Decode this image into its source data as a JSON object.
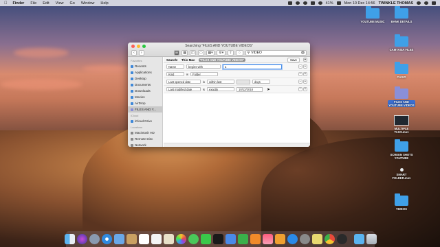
{
  "menubar": {
    "apple": "",
    "app_name": "Finder",
    "menus": [
      "File",
      "Edit",
      "View",
      "Go",
      "Window",
      "Help"
    ],
    "battery": "41%",
    "clock": "Mon 10 Dec  14:56",
    "user": "TWINKLE THOMAS"
  },
  "desktop_icons": [
    {
      "label": "YOUTUBE MUSIC",
      "kind": "folder"
    },
    {
      "label": "BANK DETAILS",
      "kind": "folder"
    },
    {
      "label": "CAMTASIA FILES",
      "kind": "folder"
    },
    {
      "label": "CASIO",
      "kind": "folder"
    },
    {
      "label": "FILES AND\nYOUTUBE VIDEOS",
      "kind": "smart-folder"
    },
    {
      "label": "MULTIPLE\nTAGS.mov",
      "kind": "movie"
    },
    {
      "label": "SCREEN SHOTS\nYOUTUBE",
      "kind": "folder"
    },
    {
      "label": "SMART\nFOLDER.mov",
      "kind": "movie"
    },
    {
      "label": "VIDEOS",
      "kind": "folder"
    }
  ],
  "window": {
    "title": "Searching “FILES AND YOUTUBE VIDEOS”",
    "search_value": "VIDEO",
    "sidebar": {
      "favorites_heading": "Favorites",
      "favorites": [
        "Recents",
        "Applications",
        "Desktop",
        "Documents",
        "Downloads",
        "Movies",
        "AirDrop",
        "FILES AND Y..."
      ],
      "icloud_heading": "iCloud",
      "icloud": [
        "iCloud Drive"
      ],
      "locations_heading": "Locations",
      "locations": [
        "Macintosh HD",
        "Remote Disc",
        "Network"
      ]
    },
    "scope": {
      "label": "Search:",
      "this_mac": "This Mac",
      "chip": "\"FILES AND YOUTUBE VIDEOS\"",
      "save": "Save",
      "plus": "+"
    },
    "rules": [
      {
        "attr": "Name",
        "op": "begins with",
        "value": "a",
        "extra": "",
        "extra2": ""
      },
      {
        "attr": "Kind",
        "op": "is",
        "value": "Folder",
        "extra": "",
        "extra2": ""
      },
      {
        "attr": "Last opened date",
        "op": "is",
        "value": "within last",
        "extra": "",
        "extra2": "days"
      },
      {
        "attr": "Last modified date",
        "op": "is",
        "value": "exactly",
        "extra": "10/12/2018",
        "extra2": ""
      }
    ]
  },
  "colors": {
    "accent": "#3b6fd0",
    "folder_blue": "#3fa0e8",
    "focus_ring": "#4a8fe8"
  },
  "dock": {
    "apps": [
      "finder-app",
      "siri-app",
      "launchpad-app",
      "safari-app",
      "mail-app",
      "notes-app",
      "contacts-app",
      "calendar-app",
      "reminders-app",
      "photos-app",
      "messages-app",
      "facetime-app",
      "maps-app",
      "keynote-app",
      "numbers-app",
      "pages-app",
      "music-app",
      "books-app",
      "appstore-app",
      "systemprefs-app",
      "preview-app",
      "chrome-app",
      "quicktime-app"
    ],
    "trash": "trash"
  }
}
